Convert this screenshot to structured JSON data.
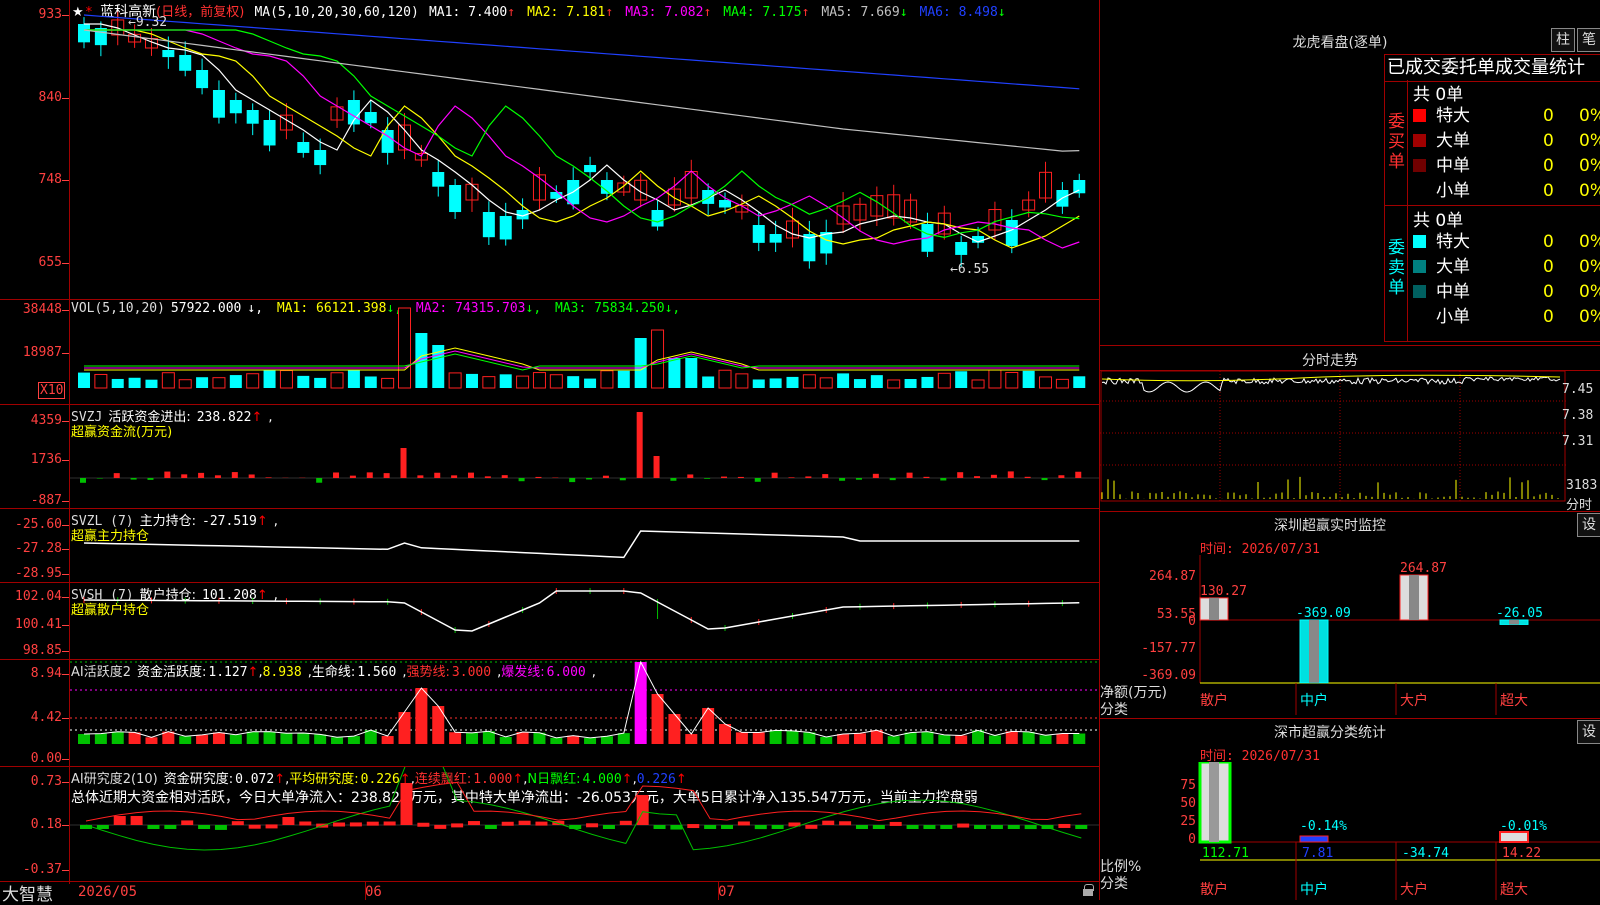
{
  "main": {
    "star": "★",
    "stock_name": "蓝科高新",
    "period": "(日线，前复权)",
    "ma_label": "MA(5,10,20,30,60,120)",
    "ma_values": [
      {
        "label": "MA1:",
        "value": "7.400",
        "arrow": "↑",
        "color": "#ffffff"
      },
      {
        "label": "MA2:",
        "value": "7.181",
        "arrow": "↑",
        "color": "#ffff00"
      },
      {
        "label": "MA3:",
        "value": "7.082",
        "arrow": "↑",
        "color": "#ff00ff"
      },
      {
        "label": "MA4:",
        "value": "7.175",
        "arrow": "↑",
        "color": "#00ff00"
      },
      {
        "label": "MA5:",
        "value": "7.669",
        "arrow": "↓",
        "color": "#c0c0c0"
      },
      {
        "label": "MA6:",
        "value": "8.498",
        "arrow": "↓",
        "color": "#2040ff"
      }
    ],
    "y_ticks": [
      "933",
      "840",
      "748",
      "655"
    ],
    "high_label": "9.32",
    "low_label": "6.55"
  },
  "vol": {
    "title": "VOL(5,10,20)",
    "value": "57922.000",
    "ma": [
      {
        "label": "MA1:",
        "value": "66121.398",
        "arrow": "↓",
        "color": "#ffff00"
      },
      {
        "label": "MA2:",
        "value": "74315.703",
        "arrow": "↓",
        "color": "#ff00ff"
      },
      {
        "label": "MA3:",
        "value": "75834.250",
        "arrow": "↓",
        "color": "#00ff00"
      }
    ],
    "y_ticks": [
      "38448",
      "18987"
    ],
    "unit": "X10"
  },
  "svzj": {
    "title": "SVZJ",
    "label": "活跃资金进出:",
    "value": "238.822",
    "arrow": "↑",
    "subtitle": "超赢资金流(万元)",
    "y_ticks": [
      "4359",
      "1736",
      "-887"
    ]
  },
  "svzl": {
    "title": "SVZL (7)",
    "label": "主力持仓:",
    "value": "-27.519",
    "arrow": "↑",
    "subtitle": "超赢主力持仓",
    "y_ticks": [
      "-25.60",
      "-27.28",
      "-28.95"
    ]
  },
  "svsh": {
    "title": "SVSH (7)",
    "label": "散户持仓:",
    "value": "101.208",
    "arrow": "↑",
    "subtitle": "超赢散户持仓",
    "y_ticks": [
      "102.04",
      "100.41",
      "98.85"
    ]
  },
  "ai_active": {
    "title": "AI活跃度2",
    "label": "资金活跃度:",
    "value": "1.127",
    "arrow": "↑",
    "v2": "8.938",
    "life_label": "生命线:",
    "life_value": "1.560",
    "strong_label": "强势线:",
    "strong_value": "3.000",
    "burst_label": "爆发线:",
    "burst_value": "6.000",
    "y_ticks": [
      "8.94",
      "4.42",
      "0.00"
    ]
  },
  "ai_research": {
    "title": "AI研究度2(10)",
    "label": "资金研究度:",
    "value": "0.072",
    "avg_label": "平均研究度:",
    "avg_value": "0.226",
    "red_label": "连续飘红:",
    "red_value": "1.000",
    "nred_label": "N日飘红:",
    "nred_value": "4.000",
    "last_value": "0.226",
    "summary": "总体近期大资金相对活跃，今日大单净流入：238.821万元，其中特大单净流出：-26.053万元，大单5日累计净入135.547万元，当前主力控盘弱",
    "y_ticks": [
      "0.73",
      "0.18",
      "-0.37"
    ]
  },
  "bottom": {
    "brand": "大智慧",
    "dates": [
      "2026/05",
      "06",
      "07"
    ]
  },
  "right": {
    "lh_title": "龙虎看盘(逐单)",
    "btn_zhu": "柱",
    "btn_bi": "笔",
    "tabs": [
      "已成交",
      "委托单",
      "成交量统计"
    ],
    "buy_side": "委买单",
    "sell_side": "委卖单",
    "buy_total": "共 0单",
    "sell_total": "共 0单",
    "buy_rows": [
      {
        "name": "特大",
        "count": "0",
        "pct": "0%",
        "color": "#ff0000"
      },
      {
        "name": "大单",
        "count": "0",
        "pct": "0%",
        "color": "#a00000"
      },
      {
        "name": "中单",
        "count": "0",
        "pct": "0%",
        "color": "#700000"
      },
      {
        "name": "小单",
        "count": "0",
        "pct": "0%",
        "color": ""
      }
    ],
    "sell_rows": [
      {
        "name": "特大",
        "count": "0",
        "pct": "0%",
        "color": "#00ffff"
      },
      {
        "name": "大单",
        "count": "0",
        "pct": "0%",
        "color": "#008080"
      },
      {
        "name": "中单",
        "count": "0",
        "pct": "0%",
        "color": "#006060"
      },
      {
        "name": "小单",
        "count": "0",
        "pct": "0%",
        "color": ""
      }
    ],
    "intraday_title": "分时走势",
    "intraday_ticks": [
      "7.45",
      "7.38",
      "7.31"
    ],
    "intraday_vol": "3183",
    "intraday_unit": "分时",
    "monitor_title": "深圳超赢实时监控",
    "monitor_btn": "设",
    "monitor_time": "时间: 2026/07/31",
    "monitor_ticks": [
      "264.87",
      "53.55",
      "0",
      "-157.77",
      "-369.09"
    ],
    "monitor_axis_label": "净额(万元)",
    "monitor_cat_label": "分类",
    "monitor_cats": [
      "散户",
      "中户",
      "大户",
      "超大"
    ],
    "monitor_values": [
      130.27,
      -369.09,
      264.87,
      -26.05
    ],
    "monitor_value_labels": [
      "130.27",
      "-369.09",
      "264.87",
      "-26.05"
    ],
    "stat_title": "深市超赢分类统计",
    "stat_btn": "设",
    "stat_time": "时间: 2026/07/31",
    "stat_ticks": [
      "75",
      "50",
      "25",
      "0"
    ],
    "stat_axis_label": "比例%",
    "stat_cat_label": "分类",
    "stat_cats": [
      "散户",
      "中户",
      "大户",
      "超大"
    ],
    "stat_values": [
      "112.71",
      "7.81",
      "-34.74",
      "14.22"
    ],
    "stat_bar_labels": [
      "",
      "-0.14%",
      "",
      "-0.01%"
    ]
  }
}
